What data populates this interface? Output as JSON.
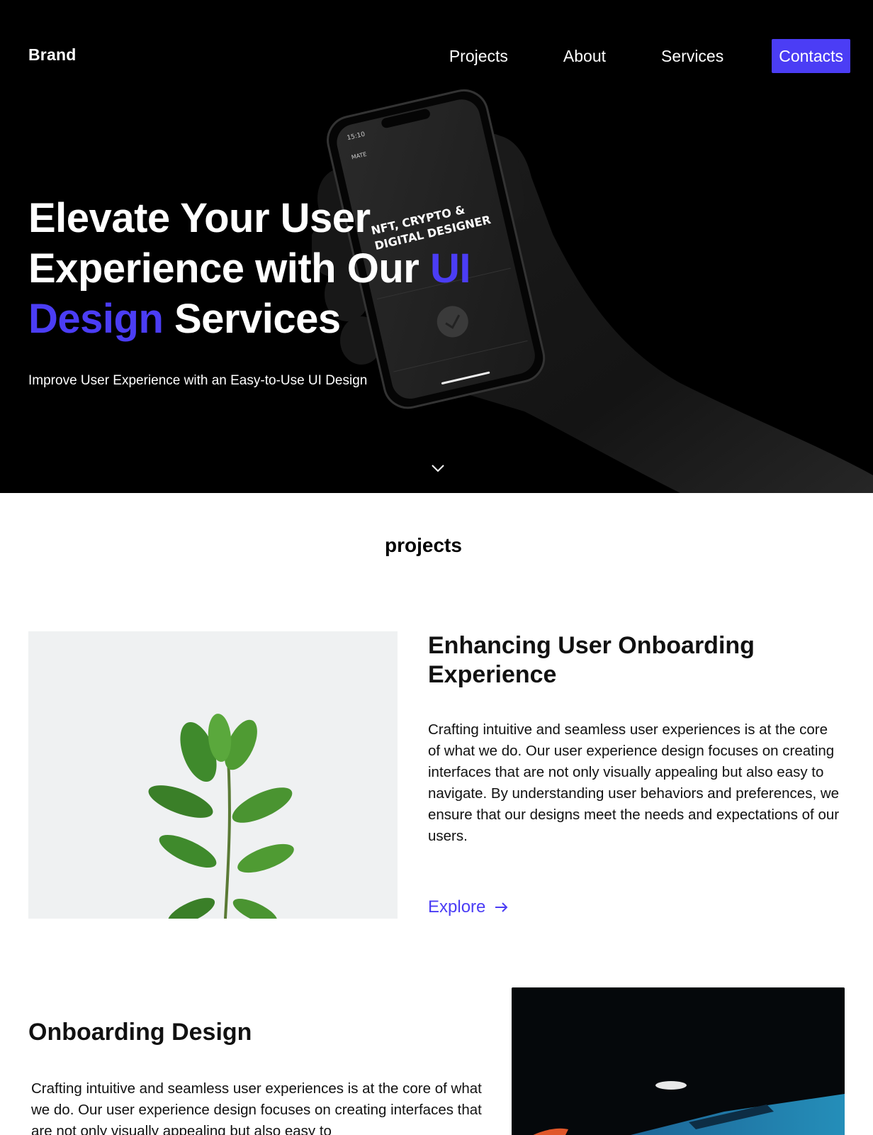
{
  "nav": {
    "brand": "Brand",
    "links": [
      "Projects",
      "About",
      "Services"
    ],
    "cta": "Contacts"
  },
  "hero": {
    "title_part1": "Elevate Your User Experience with Our ",
    "title_accent": "UI Design",
    "title_part2": " Services",
    "subtitle": "Improve User Experience with an Easy-to-Use UI Design",
    "phone": {
      "time": "15:10",
      "app_name": "MATE",
      "screen_line1": "NFT, CRYPTO &",
      "screen_line2": "DIGITAL DESIGNER"
    }
  },
  "projects": {
    "section_title": "projects",
    "items": [
      {
        "heading": "Enhancing User Onboarding Experience",
        "text": "Crafting intuitive and seamless user experiences is at the core of what we do. Our user experience design focuses on creating interfaces that are not only visually appealing but also easy to navigate. By understanding user behaviors and preferences, we ensure that our designs meet the needs and expectations of our users.",
        "link": "Explore"
      },
      {
        "heading": "Onboarding Design",
        "text": "Crafting intuitive and seamless user experiences is at the core of what we do. Our user experience design focuses on creating interfaces that are not only visually appealing but also easy to"
      }
    ]
  },
  "colors": {
    "accent": "#4b3df5",
    "hero_bg": "#000000"
  }
}
